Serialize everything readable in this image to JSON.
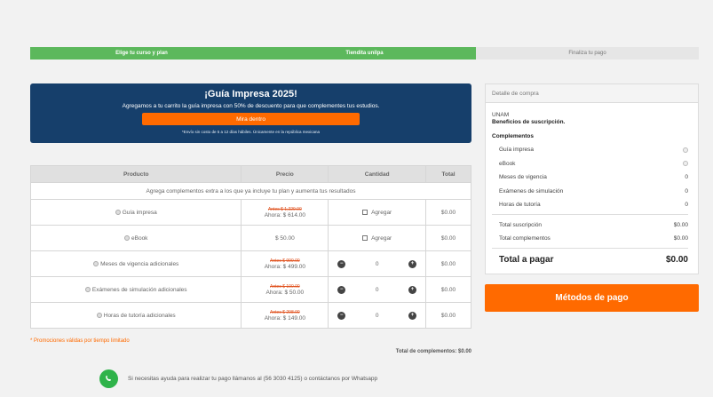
{
  "stepper": {
    "steps": [
      {
        "label": "Elige tu curso y plan",
        "state": "done"
      },
      {
        "label": "Tiendita unilpa",
        "state": "done"
      },
      {
        "label": "Finaliza tu pago",
        "state": "todo"
      }
    ]
  },
  "promo": {
    "title": "¡Guía Impresa 2025!",
    "subtitle": "Agregamos a tu carrito la guía impresa con 50% de descuento para que complementes tus estudios.",
    "button": "Mira dentro",
    "note": "*Envío sin costo de 5 a 12 días hábiles. Únicamente en la república mexicana"
  },
  "table": {
    "headers": [
      "Producto",
      "Precio",
      "Cantidad",
      "Total"
    ],
    "info": "Agrega complementos extra a los que ya incluye tu plan y aumenta tus resultados",
    "rows": [
      {
        "product": "Guía impresa",
        "old": "Antes $ 1,229.00",
        "now": "Ahora: $ 614.00",
        "qty_type": "check",
        "qty_label": "Agregar",
        "total": "$0.00"
      },
      {
        "product": "eBook",
        "old": "",
        "now": "$ 50.00",
        "qty_type": "check",
        "qty_label": "Agregar",
        "total": "$0.00"
      },
      {
        "product": "Meses de vigencia adicionales",
        "old": "Antes $ 999.00",
        "now": "Ahora: $ 499.00",
        "qty_type": "stepper",
        "qty_label": "0",
        "total": "$0.00"
      },
      {
        "product": "Exámenes de simulación adicionales",
        "old": "Antes $ 100.00",
        "now": "Ahora: $ 50.00",
        "qty_type": "stepper",
        "qty_label": "0",
        "total": "$0.00"
      },
      {
        "product": "Horas de tutoría adicionales",
        "old": "Antes $ 298.00",
        "now": "Ahora: $ 149.00",
        "qty_type": "stepper",
        "qty_label": "0",
        "total": "$0.00"
      }
    ]
  },
  "promo_limit": "* Promociones válidas por tiempo limitado",
  "total_complements": "Total de complementos: $0.00",
  "help_text": "Si necesitas ayuda para realizar tu pago llámanos al (56 3030 4125) o contáctanos por Whatsapp",
  "summary": {
    "header": "Detalle de compra",
    "org": "UNAM",
    "benefits": "Beneficios de suscripción.",
    "complements_title": "Complementos",
    "items": [
      {
        "label": "Guía impresa",
        "value": "",
        "radio": true
      },
      {
        "label": "eBook",
        "value": "",
        "radio": true
      },
      {
        "label": "Meses de vigencia",
        "value": "0",
        "radio": false
      },
      {
        "label": "Exámenes de simulación",
        "value": "0",
        "radio": false
      },
      {
        "label": "Horas de tutoría",
        "value": "0",
        "radio": false
      }
    ],
    "total_subscription_label": "Total suscripción",
    "total_subscription": "$0.00",
    "total_complements_label": "Total complementos",
    "total_complements": "$0.00",
    "grand_label": "Total a pagar",
    "grand_value": "$0.00"
  },
  "pay_button": "Métodos de pago",
  "colors": {
    "green": "#5cb85c",
    "navy": "#163f6b",
    "orange": "#ff6a00"
  }
}
